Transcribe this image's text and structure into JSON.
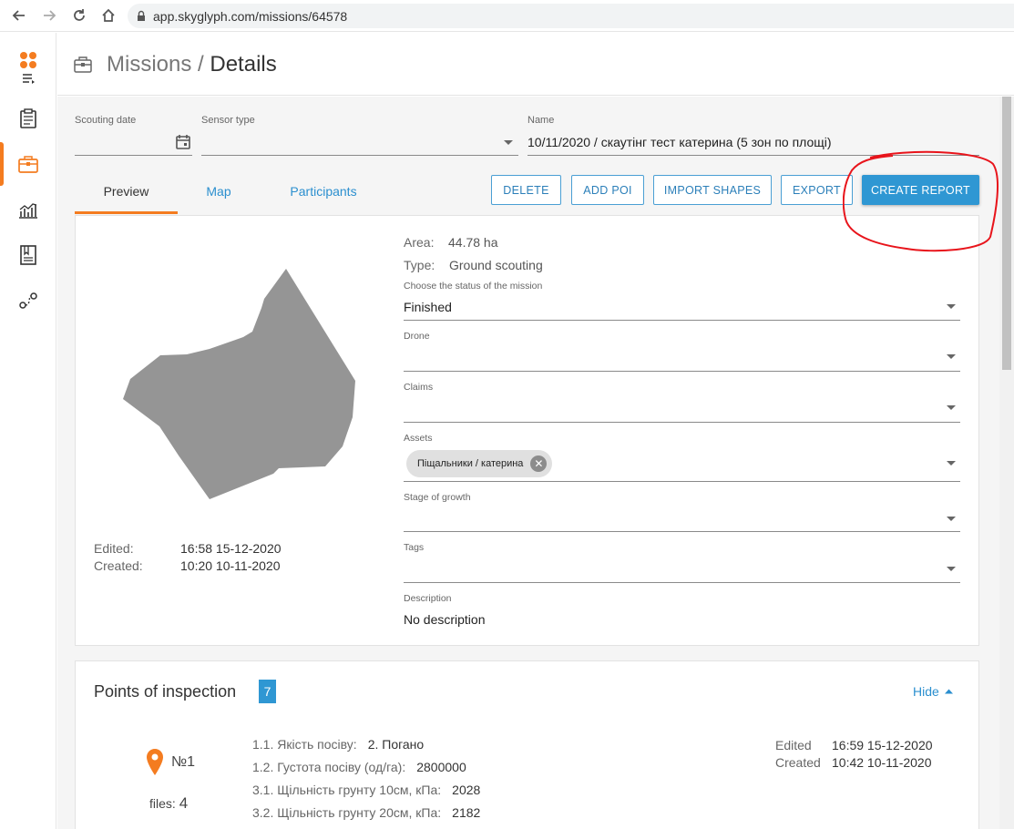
{
  "browser": {
    "url": "app.skyglyph.com/missions/64578"
  },
  "header": {
    "section": "Missions",
    "separator": " / ",
    "current": "Details"
  },
  "form": {
    "scouting_date_label": "Scouting date",
    "scouting_date_value": "",
    "sensor_type_label": "Sensor type",
    "sensor_type_value": "",
    "name_label": "Name",
    "name_value": "10/11/2020 / скаутінг тест катерина (5 зон по площі)"
  },
  "tabs": [
    {
      "label": "Preview",
      "active": true
    },
    {
      "label": "Map",
      "active": false
    },
    {
      "label": "Participants",
      "active": false
    }
  ],
  "actions": {
    "delete": "DELETE",
    "add_poi": "ADD POI",
    "import_shapes": "IMPORT SHAPES",
    "export": "EXPORT",
    "create_report": "CREATE REPORT"
  },
  "preview": {
    "edited_label": "Edited:",
    "edited_value": "16:58 15-12-2020",
    "created_label": "Created:",
    "created_value": "10:20 10-11-2020",
    "area_label": "Area:",
    "area_value": "44.78 ha",
    "type_label": "Type:",
    "type_value": "Ground scouting",
    "status_label": "Choose the status of the mission",
    "status_value": "Finished",
    "drone_label": "Drone",
    "drone_value": "",
    "claims_label": "Claims",
    "claims_value": "",
    "assets_label": "Assets",
    "assets_chip": "Піщальники / катерина",
    "stage_label": "Stage of growth",
    "stage_value": "",
    "tags_label": "Tags",
    "tags_value": "",
    "description_label": "Description",
    "description_value": "No description"
  },
  "points": {
    "title": "Points of inspection",
    "count": "7",
    "hide_label": "Hide",
    "items": [
      {
        "number": "№1",
        "files_label": "files:",
        "files_count": "4",
        "lines": [
          {
            "label": "1.1. Якість посіву:",
            "value": "2. Погано"
          },
          {
            "label": "1.2. Густота посіву (од/га):",
            "value": "2800000"
          },
          {
            "label": "3.1. Щільність грунту 10см, кПа:",
            "value": "2028"
          },
          {
            "label": "3.2. Щільність грунту 20см, кПа:",
            "value": "2182"
          }
        ],
        "edited_label": "Edited",
        "edited_value": "16:59 15-12-2020",
        "created_label": "Created",
        "created_value": "10:42 10-11-2020"
      }
    ]
  },
  "colors": {
    "accent": "#f47c20",
    "primary": "#2f97d3",
    "link": "#2b8fcf",
    "annotation": "#e8141b",
    "shape_fill": "#959595"
  },
  "icons": {
    "back": "arrow-left-icon",
    "forward": "arrow-right-icon",
    "reload": "reload-icon",
    "home": "home-icon",
    "lock": "lock-icon",
    "logo": "logo-icon",
    "menu": "menu-icon",
    "clipboard": "clipboard-icon",
    "briefcase": "briefcase-icon",
    "chart": "chart-icon",
    "document": "document-icon",
    "route": "route-icon",
    "calendar": "calendar-icon",
    "pin": "map-pin-icon"
  }
}
